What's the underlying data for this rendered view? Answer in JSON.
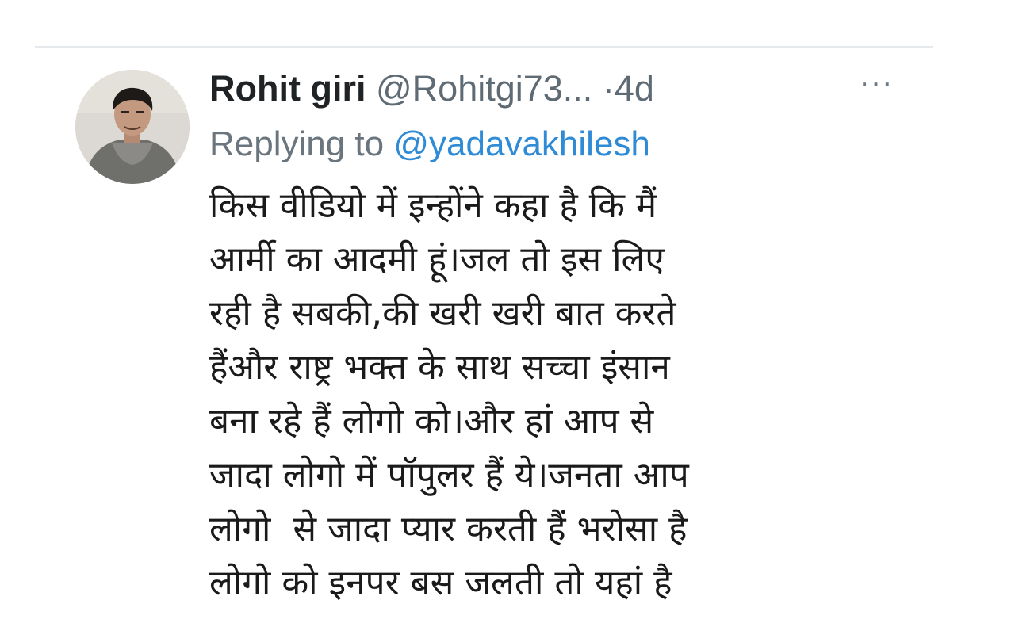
{
  "tweet": {
    "author_name": "Rohit giri",
    "handle": "@Rohitgi73...",
    "separator": "·",
    "time": "4d",
    "more_label": "···",
    "replying_prefix": "Replying to",
    "replying_to": "@yadavakhilesh",
    "body_lines": [
      "किस वीडियो में इन्होंने कहा है कि मैं",
      "आर्मी का आदमी हूं।जल तो इस लिए",
      "रही है सबकी,की खरी खरी बात करते",
      "हैंऔर राष्ट्र भक्त के साथ सच्चा इंसान",
      "बना रहे हैं लोगो को।और हां आप से",
      "जादा लोगो में पॉपुलर हैं ये।जनता आप",
      "लोगो  से जादा प्यार करती हैं भरोसा है",
      "लोगो को इनपर बस जलती तो यहां है"
    ]
  },
  "icons": {
    "more": "more-horizontal-icon"
  }
}
